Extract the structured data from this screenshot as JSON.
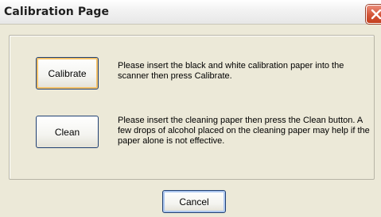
{
  "window": {
    "title": "Calibration Page"
  },
  "calibrate": {
    "button_label": "Calibrate",
    "description": "Please insert the black and white calibration paper into the scanner then press Calibrate."
  },
  "clean": {
    "button_label": "Clean",
    "description": "Please insert the cleaning paper then press the Clean button. A few drops of alcohol placed on the cleaning paper may help if the paper alone is not effective."
  },
  "footer": {
    "cancel_label": "Cancel"
  },
  "icons": {
    "close": "close-icon"
  },
  "colors": {
    "close_button": "#d35437",
    "focus_ring": "#f4c26a",
    "dialog_bg": "#ECE9D8"
  }
}
